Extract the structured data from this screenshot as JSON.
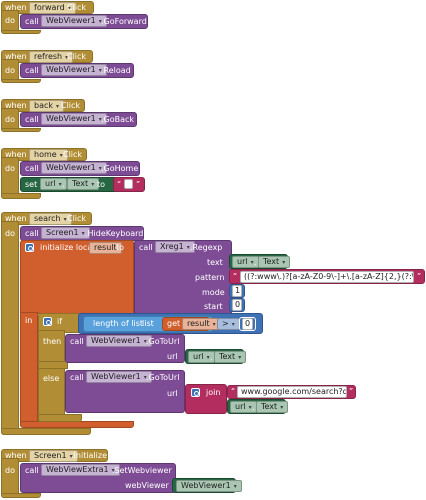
{
  "kw": {
    "when": "when",
    "do": "do",
    "call": "call",
    "set": "set",
    "to": "to",
    "initialize_local": "initialize local",
    "in": "in",
    "if": "if",
    "then": "then",
    "else": "else",
    "get": "get",
    "join": "join",
    "length_of_list": "length of list",
    "list": "list"
  },
  "events": [
    {
      "component": "forward",
      "event": "Click",
      "call_component": "WebViewer1",
      "call_method": ".GoForward"
    },
    {
      "component": "refresh",
      "event": "Click",
      "call_component": "WebViewer1",
      "call_method": ".Reload"
    },
    {
      "component": "back",
      "event": "Click",
      "call_component": "WebViewer1",
      "call_method": ".GoBack"
    },
    {
      "component": "home",
      "event": "Click",
      "call_component": "WebViewer1",
      "call_method": ".GoHome"
    }
  ],
  "home_set": {
    "component": "url",
    "property": "Text",
    "string": ""
  },
  "search": {
    "component": "search",
    "event": "Click",
    "call_component": "Screen1",
    "call_method": ".HideKeyboard",
    "local_var": "result",
    "regex_component": "Xreg1",
    "regex_method": ".Regexp",
    "param_text": "text",
    "param_pattern": "pattern",
    "param_mode": "mode",
    "param_start": "start",
    "text_component": "url",
    "text_property": "Text",
    "pattern": "((?:www\\.)?[a-zA-Z0-9\\-]+\\.[a-zA-Z]{2,}(?:\\/\\S...",
    "mode": "1",
    "start": "0",
    "compare_op": ">",
    "compare_value": "0",
    "get_var": "result",
    "then_component": "WebViewer1",
    "then_method": ".GoToUrl",
    "param_url": "url",
    "then_url_component": "url",
    "then_url_property": "Text",
    "else_component": "WebViewer1",
    "else_method": ".GoToUrl",
    "join_string": "www.google.com/search?q=",
    "join_component": "url",
    "join_property": "Text"
  },
  "init": {
    "component": "Screen1",
    "event": ".Initialize",
    "call_component": "WebViewExtra1",
    "call_method": ".SetWebviewer",
    "param": "webViewer",
    "param_value": "WebViewer1"
  }
}
